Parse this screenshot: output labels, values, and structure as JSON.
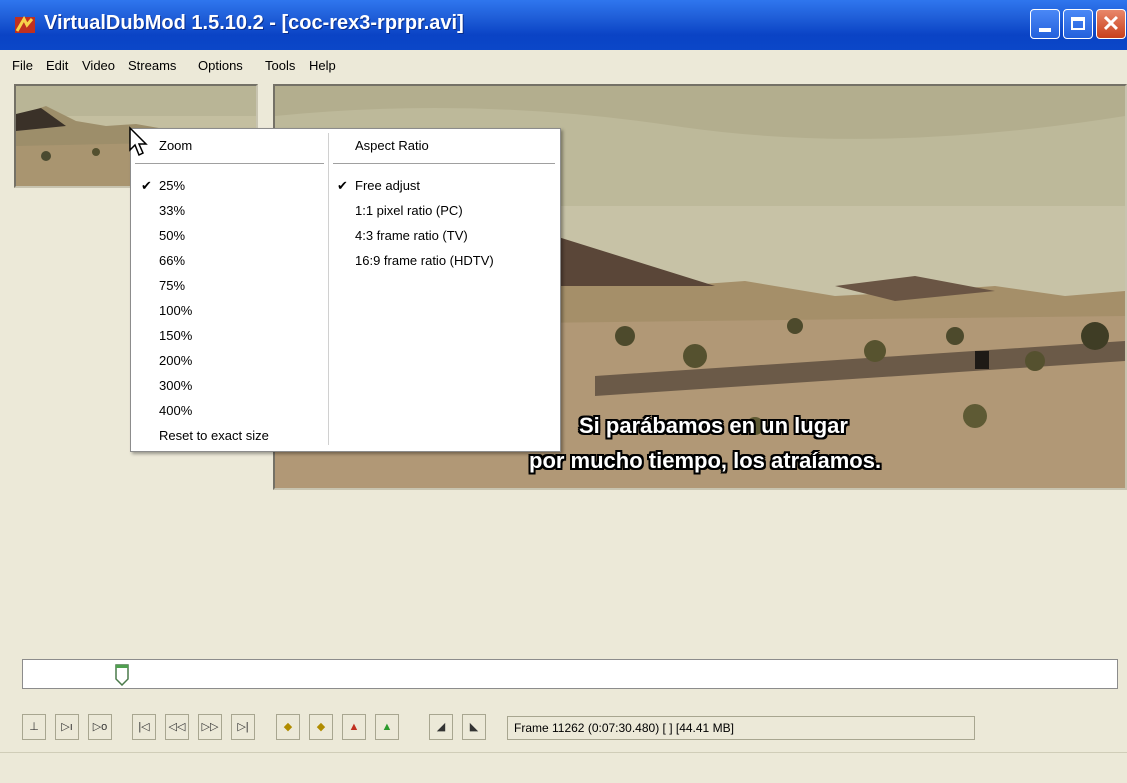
{
  "window": {
    "title": "VirtualDubMod 1.5.10.2 - [coc-rex3-rprpr.avi]",
    "accent": "#0a43c5"
  },
  "menubar": [
    "File",
    "Edit",
    "Video",
    "Streams",
    "Options",
    "Tools",
    "Help"
  ],
  "context_menu": {
    "zoom_header": "Zoom",
    "zoom_items": [
      "25%",
      "33%",
      "50%",
      "66%",
      "75%",
      "100%",
      "150%",
      "200%",
      "300%",
      "400%",
      "Reset to exact size"
    ],
    "zoom_checked": "25%",
    "aspect_header": "Aspect Ratio",
    "aspect_items": [
      "Free adjust",
      "1:1 pixel ratio (PC)",
      "4:3 frame ratio (TV)",
      "16:9 frame ratio (HDTV)"
    ],
    "aspect_checked": "Free adjust"
  },
  "subtitle": {
    "line1": "Si parábamos en un lugar",
    "line2": "por mucho tiempo, los atraíamos."
  },
  "timeline": {
    "position_fraction": 0.088
  },
  "status": {
    "text": "Frame 11262 (0:07:30.480) [ ] [44.41 MB]"
  },
  "toolbar_icons": [
    "stop-icon",
    "play-input-icon",
    "play-output-icon",
    "go-to-start-icon",
    "step-back-icon",
    "step-forward-icon",
    "go-to-end-icon",
    "prev-keyframe-icon",
    "next-keyframe-icon",
    "scene-back-icon",
    "scene-forward-icon",
    "mark-in-icon",
    "mark-out-icon"
  ]
}
